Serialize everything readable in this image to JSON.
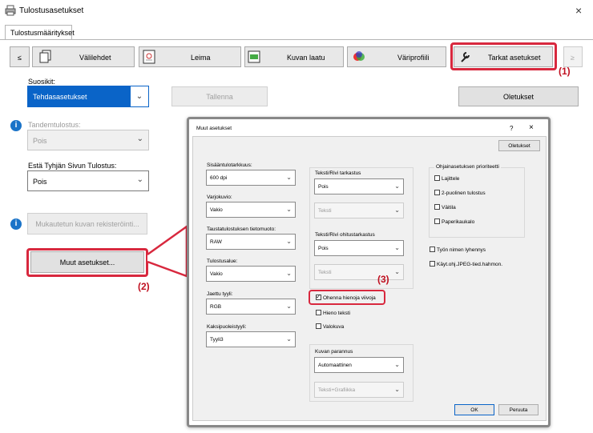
{
  "window": {
    "title": "Tulostusasetukset",
    "close": "×"
  },
  "tab": {
    "label": "Tulostusmääritykset"
  },
  "toolbar": {
    "prev": "≤",
    "next": "≥",
    "buttons": [
      {
        "label": "Välilehdet",
        "icon": "tabs-icon"
      },
      {
        "label": "Leima",
        "icon": "stamp-icon"
      },
      {
        "label": "Kuvan laatu",
        "icon": "image-quality-icon"
      },
      {
        "label": "Väriprofiili",
        "icon": "color-profile-icon"
      },
      {
        "label": "Tarkat asetukset",
        "icon": "wrench-icon"
      }
    ]
  },
  "favorites": {
    "label": "Suosikit:",
    "value": "Tehdasasetukset",
    "save": "Tallenna",
    "defaults": "Oletukset"
  },
  "tandem": {
    "label": "Tandemtulostus:",
    "value": "Pois"
  },
  "blank_page": {
    "label": "Estä Tyhjän Sivun Tulostus:",
    "value": "Pois"
  },
  "custom_image": {
    "label": "Mukautetun kuvan rekisteröinti..."
  },
  "other_settings": {
    "label": "Muut asetukset..."
  },
  "callouts": {
    "c1": "(1)",
    "c2": "(2)",
    "c3": "(3)"
  },
  "dialog": {
    "title": "Muut asetukset",
    "help": "?",
    "close": "×",
    "defaults": "Oletukset",
    "input_resolution": {
      "label": "Sisääntulotarkkuus:",
      "value": "600 dpi"
    },
    "shading": {
      "label": "Varjokuvio:",
      "value": "Vakio"
    },
    "spool_format": {
      "label": "Taustatulostuksen tietomuoto:",
      "value": "RAW"
    },
    "print_area": {
      "label": "Tulostusalue:",
      "value": "Vakio"
    },
    "color_mode": {
      "label": "Jaettu tyyli:",
      "value": "RGB"
    },
    "duplex_style": {
      "label": "Kaksipuoleistyyli:",
      "value": "Tyyli3"
    },
    "text_line": {
      "label": "Teksti/Rivi tarkastus",
      "value": "Pois",
      "sub": "Teksti"
    },
    "text_line_thin": {
      "label": "Teksti/Rivi ohitustarkastus",
      "value": "Pois",
      "sub": "Teksti"
    },
    "checks": [
      {
        "label": "Ohenna hienoja viivoja",
        "checked": true
      },
      {
        "label": "Hieno teksti",
        "checked": false
      },
      {
        "label": "Valokuva",
        "checked": false
      }
    ],
    "image_enhance": {
      "label": "Kuvan parannus",
      "value": "Automaattinen",
      "sub": "Teksti+Grafiikka"
    },
    "priority": {
      "label": "Ohjainasetuksen prioriteetti",
      "items": [
        "Lajittele",
        "2-puolinen tulostus",
        "Väitila",
        "Paperikaukalo"
      ]
    },
    "extra": [
      "Työn nimen lyhennys",
      "Käyt.ohj.JPEG-tied.hahmon."
    ],
    "ok": "OK",
    "cancel": "Peruuta"
  }
}
